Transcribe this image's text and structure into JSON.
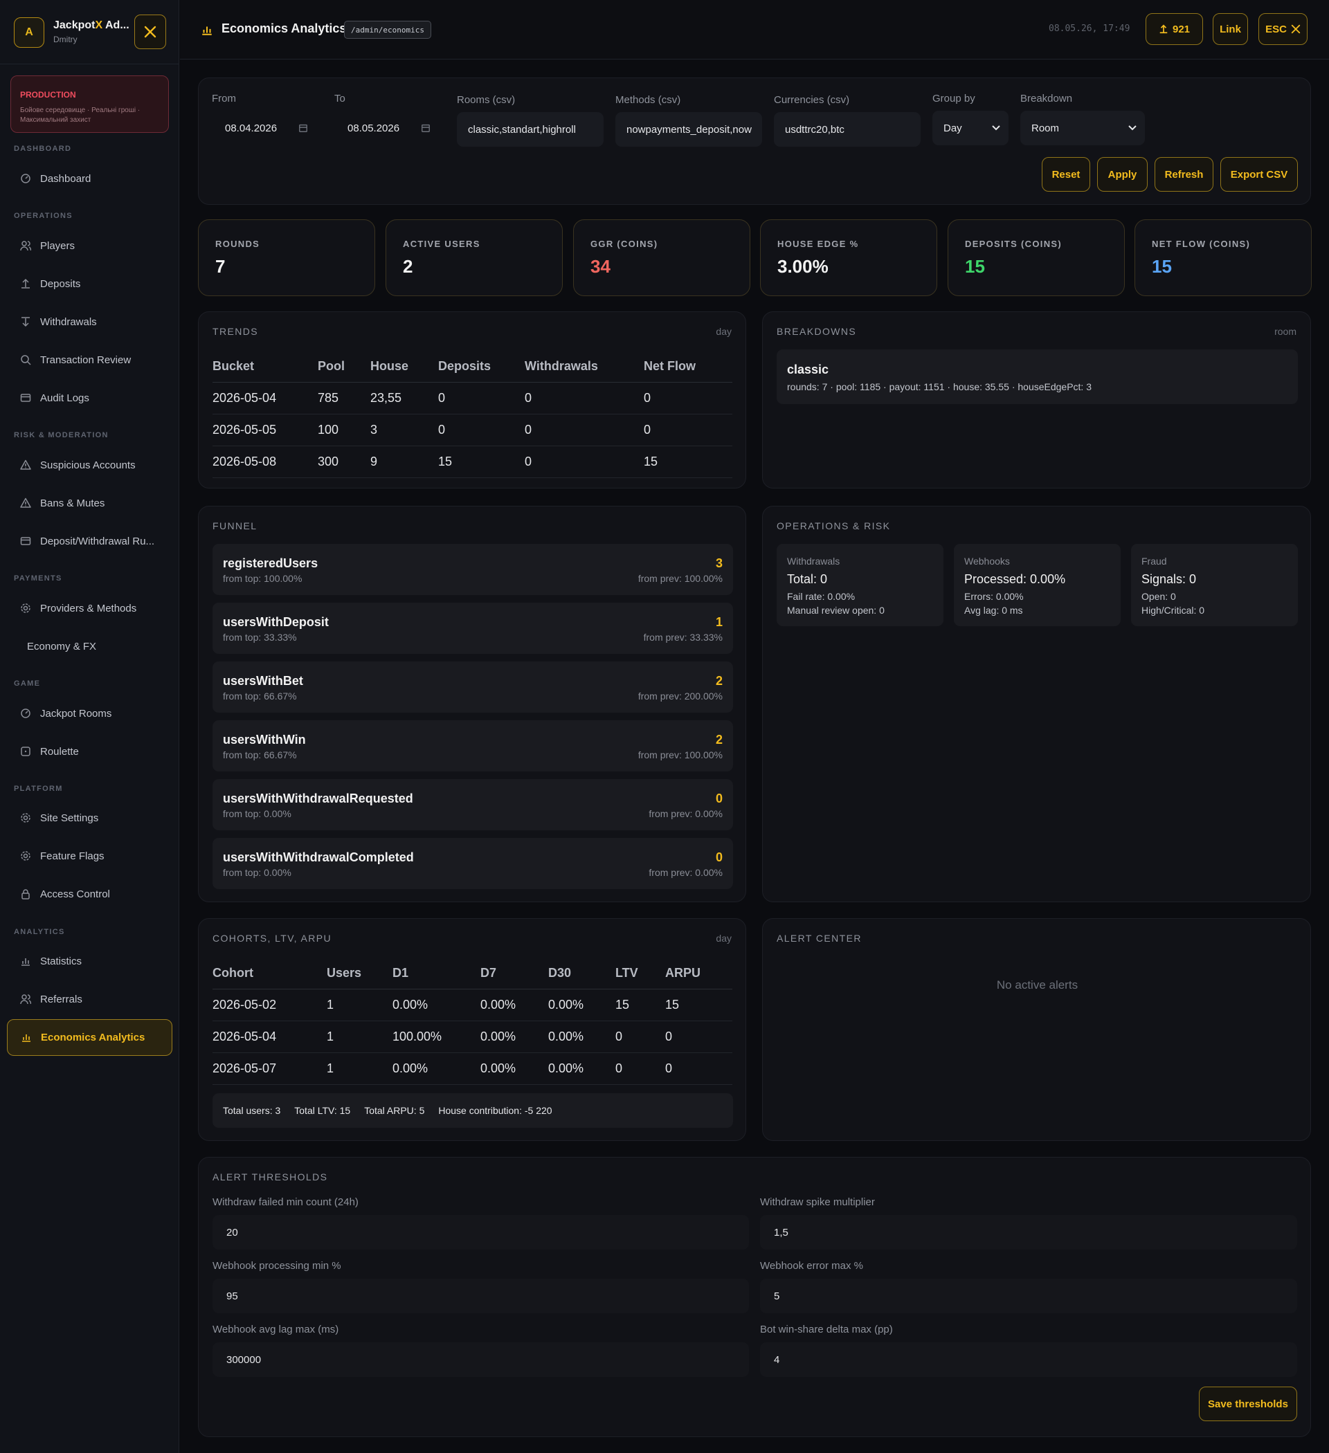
{
  "sidebar": {
    "avatar_letter": "A",
    "brand_prefix": "Jackpot",
    "brand_accent": "X",
    "brand_suffix": " Ad...",
    "user_name": "Dmitry",
    "env_title": "PRODUCTION",
    "env_desc": "Бойове середовище · Реальні гроші · Максимальний захист",
    "sections": {
      "dashboard": "DASHBOARD",
      "operations": "OPERATIONS",
      "risk": "RISK & MODERATION",
      "payments": "PAYMENTS",
      "game": "GAME",
      "platform": "PLATFORM",
      "analytics": "ANALYTICS"
    },
    "items": {
      "dashboard": "Dashboard",
      "players": "Players",
      "deposits": "Deposits",
      "withdrawals": "Withdrawals",
      "transaction_review": "Transaction Review",
      "audit_logs": "Audit Logs",
      "suspicious": "Suspicious Accounts",
      "bans": "Bans & Mutes",
      "dw_rules": "Deposit/Withdrawal Ru...",
      "providers": "Providers & Methods",
      "economy": "Economy & FX",
      "jackpot_rooms": "Jackpot Rooms",
      "roulette": "Roulette",
      "site_settings": "Site Settings",
      "feature_flags": "Feature Flags",
      "access_control": "Access Control",
      "statistics": "Statistics",
      "referrals": "Referrals",
      "economics": "Economics Analytics"
    }
  },
  "topbar": {
    "title": "Economics Analytics",
    "path": "/admin/economics",
    "datetime": "08.05.26, 17:49",
    "counter": "921",
    "link_label": "Link",
    "esc_label": "ESC"
  },
  "filters": {
    "from_label": "From",
    "from_value": "08.04.2026",
    "to_label": "To",
    "to_value": "08.05.2026",
    "rooms_label": "Rooms (csv)",
    "rooms_value": "classic,standart,highroll",
    "methods_label": "Methods (csv)",
    "methods_value": "nowpayments_deposit,now",
    "currencies_label": "Currencies (csv)",
    "currencies_value": "usdttrc20,btc",
    "group_label": "Group by",
    "group_value": "Day",
    "breakdown_label": "Breakdown",
    "breakdown_value": "Room",
    "reset": "Reset",
    "apply": "Apply",
    "refresh": "Refresh",
    "export": "Export CSV"
  },
  "kpis": [
    {
      "label": "ROUNDS",
      "value": "7",
      "color": "#f2f2f2"
    },
    {
      "label": "ACTIVE USERS",
      "value": "2",
      "color": "#f2f2f2"
    },
    {
      "label": "GGR (COINS)",
      "value": "34",
      "color": "#f0665f"
    },
    {
      "label": "HOUSE EDGE %",
      "value": "3.00%",
      "color": "#f2f2f2"
    },
    {
      "label": "DEPOSITS (COINS)",
      "value": "15",
      "color": "#3ed66a"
    },
    {
      "label": "NET FLOW (COINS)",
      "value": "15",
      "color": "#5aa4f5"
    }
  ],
  "trends": {
    "title": "TRENDS",
    "meta": "day",
    "headers": [
      "Bucket",
      "Pool",
      "House",
      "Deposits",
      "Withdrawals",
      "Net Flow"
    ],
    "rows": [
      [
        "2026-05-04",
        "785",
        "23,55",
        "0",
        "0",
        "0"
      ],
      [
        "2026-05-05",
        "100",
        "3",
        "0",
        "0",
        "0"
      ],
      [
        "2026-05-08",
        "300",
        "9",
        "15",
        "0",
        "15"
      ]
    ]
  },
  "breakdowns": {
    "title": "BREAKDOWNS",
    "meta": "room",
    "item_name": "classic",
    "item_detail": "rounds: 7 · pool: 1185 · payout: 1151 · house: 35.55 · houseEdgePct: 3"
  },
  "funnel": {
    "title": "FUNNEL",
    "items": [
      {
        "name": "registeredUsers",
        "value": "3",
        "top": "from top: 100.00%",
        "prev": "from prev: 100.00%"
      },
      {
        "name": "usersWithDeposit",
        "value": "1",
        "top": "from top: 33.33%",
        "prev": "from prev: 33.33%"
      },
      {
        "name": "usersWithBet",
        "value": "2",
        "top": "from top: 66.67%",
        "prev": "from prev: 200.00%"
      },
      {
        "name": "usersWithWin",
        "value": "2",
        "top": "from top: 66.67%",
        "prev": "from prev: 100.00%"
      },
      {
        "name": "usersWithWithdrawalRequested",
        "value": "0",
        "top": "from top: 0.00%",
        "prev": "from prev: 0.00%"
      },
      {
        "name": "usersWithWithdrawalCompleted",
        "value": "0",
        "top": "from top: 0.00%",
        "prev": "from prev: 0.00%"
      }
    ]
  },
  "operations": {
    "title": "OPERATIONS & RISK",
    "withdrawals": {
      "title": "Withdrawals",
      "main": "Total: 0",
      "sub1": "Fail rate: 0.00%",
      "sub2": "Manual review open: 0"
    },
    "webhooks": {
      "title": "Webhooks",
      "main": "Processed: 0.00%",
      "sub1": "Errors: 0.00%",
      "sub2": "Avg lag: 0 ms"
    },
    "fraud": {
      "title": "Fraud",
      "main": "Signals: 0",
      "sub1": "Open: 0",
      "sub2": "High/Critical: 0"
    }
  },
  "cohorts": {
    "title": "COHORTS, LTV, ARPU",
    "meta": "day",
    "headers": [
      "Cohort",
      "Users",
      "D1",
      "D7",
      "D30",
      "LTV",
      "ARPU"
    ],
    "rows": [
      [
        "2026-05-02",
        "1",
        "0.00%",
        "0.00%",
        "0.00%",
        "15",
        "15"
      ],
      [
        "2026-05-04",
        "1",
        "100.00%",
        "0.00%",
        "0.00%",
        "0",
        "0"
      ],
      [
        "2026-05-07",
        "1",
        "0.00%",
        "0.00%",
        "0.00%",
        "0",
        "0"
      ]
    ],
    "total_users": "Total users: 3",
    "total_ltv": "Total LTV: 15",
    "total_arpu": "Total ARPU: 5",
    "house_contribution": "House contribution: -5 220"
  },
  "alerts": {
    "title": "ALERT CENTER",
    "empty": "No active alerts"
  },
  "thresholds": {
    "title": "ALERT THRESHOLDS",
    "withdraw_failed_label": "Withdraw failed min count (24h)",
    "withdraw_failed_value": "20",
    "withdraw_spike_label": "Withdraw spike multiplier",
    "withdraw_spike_value": "1,5",
    "webhook_processing_label": "Webhook processing min %",
    "webhook_processing_value": "95",
    "webhook_error_label": "Webhook error max %",
    "webhook_error_value": "5",
    "webhook_lag_label": "Webhook avg lag max (ms)",
    "webhook_lag_value": "300000",
    "bot_winshare_label": "Bot win-share delta max (pp)",
    "bot_winshare_value": "4",
    "save": "Save thresholds"
  }
}
